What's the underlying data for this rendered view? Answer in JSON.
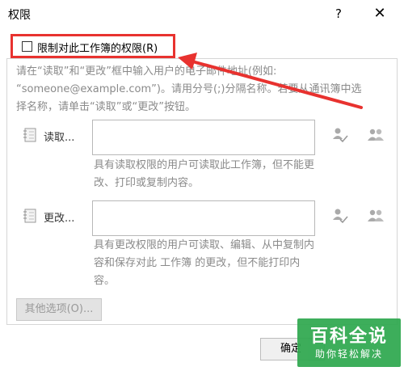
{
  "window": {
    "title": "权限",
    "help_label": "?",
    "close_label": "✕"
  },
  "restrict": {
    "label": "限制对此工作簿的权限(R)",
    "checked": false
  },
  "instructions": "请在“读取”和“更改”框中输入用户的电子邮件地址(例如: “someone@example.com”)。请用分号(;)分隔名称。若要从通讯簿中选择名称，请单击“读取”或“更改”按钮。",
  "read": {
    "label": "读取...",
    "value": "",
    "description": "具有读取权限的用户可读取此工作簿，但不能更改、打印或复制内容。",
    "icon": "address-book-icon"
  },
  "change": {
    "label": "更改...",
    "value": "",
    "description": "具有更改权限的用户可读取、编辑、从中复制内容和保存对此 工作簿 的更改，但不能打印内容。",
    "icon": "address-book-icon"
  },
  "more_options_label": "其他选项(O)...",
  "ok_label": "确定",
  "watermark": {
    "title": "百科全说",
    "subtitle": "助你轻松解决"
  },
  "colors": {
    "highlight": "#e8322f",
    "watermark": "#2fa84f",
    "muted_text": "#8a8a8a"
  }
}
